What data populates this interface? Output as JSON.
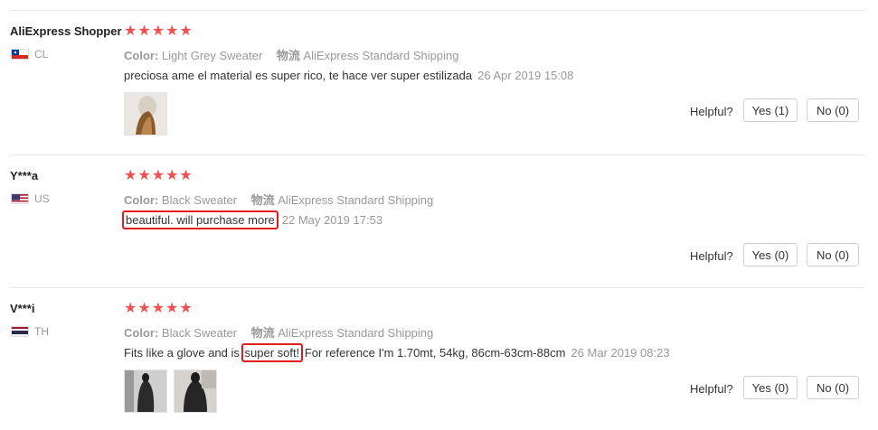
{
  "labels": {
    "color_label": "Color:",
    "shipping_label": "物流",
    "helpful_label": "Helpful?"
  },
  "colors": {
    "star": "#f0504f",
    "highlight": "#e41c1c"
  },
  "reviews": [
    {
      "name": "AliExpress Shopper",
      "country": "CL",
      "rating": 5,
      "color_value": "Light Grey Sweater",
      "shipping_value": "AliExpress Standard Shipping",
      "text": "preciosa ame el material es super rico, te hace ver super estilizada",
      "date": "26 Apr 2019 15:08",
      "yes": "Yes (1)",
      "no": "No (0)"
    },
    {
      "name": "Y***a",
      "country": "US",
      "rating": 5,
      "color_value": "Black Sweater",
      "shipping_value": "AliExpress Standard Shipping",
      "text": "beautiful. will purchase more",
      "date": "22 May 2019 17:53",
      "yes": "Yes (0)",
      "no": "No (0)"
    },
    {
      "name": "V***i",
      "country": "TH",
      "rating": 5,
      "color_value": "Black Sweater",
      "shipping_value": "AliExpress Standard Shipping",
      "text_before": "Fits like a glove and is ",
      "text_highlight": "super soft!",
      "text_after": " For reference I'm 1.70mt, 54kg, 86cm-63cm-88cm",
      "date": "26 Mar 2019 08:23",
      "yes": "Yes (0)",
      "no": "No (0)"
    }
  ]
}
